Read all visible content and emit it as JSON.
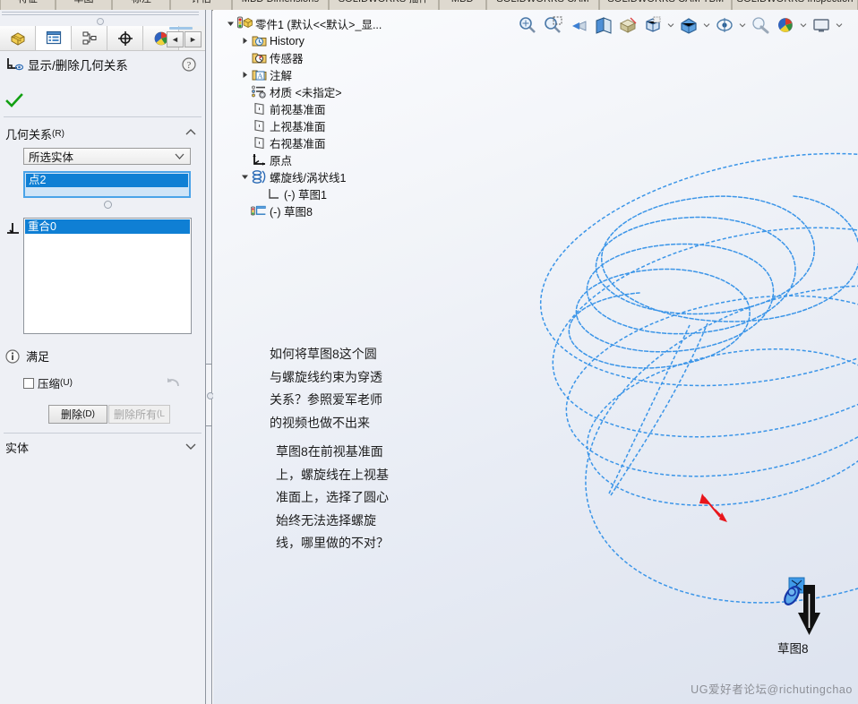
{
  "ribbon_tabs": [
    {
      "label": "特征",
      "width": 70
    },
    {
      "label": "草图",
      "width": 72
    },
    {
      "label": "标注",
      "width": 74
    },
    {
      "label": "评估",
      "width": 78
    },
    {
      "label": "MBD Dimensions",
      "width": 122
    },
    {
      "label": "SOLIDWORKS 插件",
      "width": 140
    },
    {
      "label": "MBD",
      "width": 60
    },
    {
      "label": "SOLIDWORKS CAM",
      "width": 144
    },
    {
      "label": "SOLIDWORKS CAM TBM",
      "width": 168
    },
    {
      "label": "SOLIDWORKS Inspection",
      "width": 160
    }
  ],
  "property_manager": {
    "tabs": [
      {
        "name": "feature-manager-tab",
        "icon": "yellow-block-icon"
      },
      {
        "name": "property-manager-tab",
        "icon": "list-panel-icon"
      },
      {
        "name": "configuration-manager-tab",
        "icon": "configuration-icon"
      },
      {
        "name": "dimxpert-manager-tab",
        "icon": "crosshair-icon"
      },
      {
        "name": "display-manager-tab",
        "icon": "color-sphere-icon"
      }
    ],
    "nav_prev": "◄",
    "nav_next": "►",
    "title": "显示/删除几何关系",
    "help_icon": "question-mark-icon",
    "ok_icon": "green-check-icon",
    "section": {
      "label": "几何关系",
      "hotkey": "(R)",
      "collapse_icon": "chevron-up-icon"
    },
    "filter_combo": {
      "value": "所选实体",
      "chevron": "chevron-down-icon"
    },
    "entity_list": {
      "items": [
        "点2"
      ],
      "selected_index": 0
    },
    "relation_list": {
      "items": [
        "重合0"
      ],
      "selected_index": 0,
      "icon": "coincident-relation-icon"
    },
    "status": {
      "icon": "info-icon",
      "text": "满足"
    },
    "suppress_checkbox": {
      "label": "压缩",
      "hotkey": "(U)",
      "checked": false
    },
    "undo_icon": "undo-arrow-icon",
    "buttons": {
      "delete": {
        "label": "删除",
        "hotkey": "(D)",
        "enabled": true
      },
      "delete_all": {
        "label": "删除所有",
        "hotkey": "(L",
        "enabled": false
      }
    },
    "entities_section": {
      "label": "实体",
      "chevron": "chevron-down-icon"
    }
  },
  "view_toolbar": [
    {
      "name": "zoom-to-fit-icon",
      "caret": false
    },
    {
      "name": "zoom-to-area-icon",
      "caret": false
    },
    {
      "name": "previous-view-icon",
      "caret": false
    },
    {
      "name": "section-view-icon",
      "caret": false
    },
    {
      "name": "view-orientation-icon",
      "caret": false
    },
    {
      "name": "display-style-icon",
      "caret": true
    },
    {
      "name": "hide-show-items-icon",
      "caret": true
    },
    {
      "name": "edit-appearance-icon",
      "caret": true
    },
    {
      "name": "apply-scene-icon",
      "caret": false
    },
    {
      "name": "view-settings-icon",
      "caret": true
    },
    {
      "name": "viewport-icon",
      "caret": true
    }
  ],
  "feature_tree": [
    {
      "indent": 0,
      "caret": "down",
      "icon": "part-icon",
      "label": "零件1  (默认<<默认>_显..."
    },
    {
      "indent": 1,
      "caret": "right",
      "icon": "history-icon",
      "label": "History"
    },
    {
      "indent": 1,
      "caret": "none",
      "icon": "sensor-icon",
      "label": "传感器"
    },
    {
      "indent": 1,
      "caret": "right",
      "icon": "annotations-icon",
      "label": "注解"
    },
    {
      "indent": 1,
      "caret": "none",
      "icon": "material-icon",
      "label": "材质 <未指定>"
    },
    {
      "indent": 1,
      "caret": "none",
      "icon": "plane-icon",
      "label": "前视基准面"
    },
    {
      "indent": 1,
      "caret": "none",
      "icon": "plane-icon",
      "label": "上视基准面"
    },
    {
      "indent": 1,
      "caret": "none",
      "icon": "plane-icon",
      "label": "右视基准面"
    },
    {
      "indent": 1,
      "caret": "none",
      "icon": "origin-icon",
      "label": "原点"
    },
    {
      "indent": 1,
      "caret": "down",
      "icon": "helix-icon",
      "label": "螺旋线/涡状线1"
    },
    {
      "indent": 2,
      "caret": "none",
      "icon": "sketch-icon",
      "label": "(-) 草图1"
    },
    {
      "indent": 1,
      "caret": "none",
      "icon": "sketch-edit-icon",
      "label": "(-) 草图8"
    }
  ],
  "annotations": {
    "question_lines": [
      "如何将草图8这个圆",
      "与螺旋线约束为穿透",
      "关系？参照爱军老师",
      "的视频也做不出来"
    ],
    "detail_lines": [
      "草图8在前视基准面",
      "上，螺旋线在上视基",
      "准面上，选择了圆心",
      "始终无法选择螺旋",
      "线，哪里做的不对？"
    ],
    "sketch_callout": "草图8",
    "watermark": "UG爱好者论坛@richutingchao"
  },
  "colors": {
    "sketch_blue": "#3b95e8",
    "selection_blue": "#0f7fd4",
    "arrow_red": "#e8161c",
    "graphics_bg_top": "#fbfcfe",
    "graphics_bg_bottom": "#dde3ef"
  }
}
